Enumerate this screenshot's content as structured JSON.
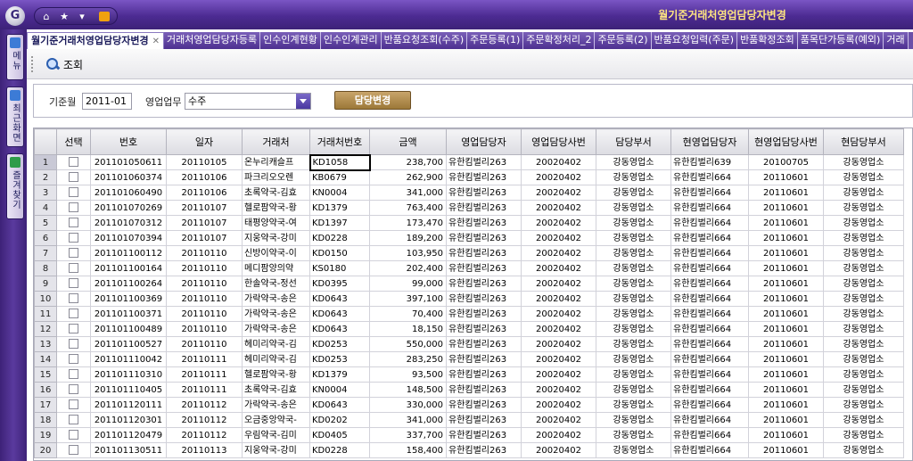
{
  "app": {
    "title": "월기준거래처영업담당자변경",
    "logo_letter": "G"
  },
  "sidebar": {
    "items": [
      {
        "label": "메뉴",
        "icon": "menu-icon"
      },
      {
        "label": "최근화면",
        "icon": "recent-screen-icon"
      },
      {
        "label": "즐겨찾기",
        "icon": "favorites-icon"
      }
    ]
  },
  "tabs": [
    {
      "label": "월기준거래처영업담당자변경",
      "active": true
    },
    {
      "label": "거래처영업담당자등록"
    },
    {
      "label": "인수인계현황"
    },
    {
      "label": "인수인계관리"
    },
    {
      "label": "반품요청조회(수주)"
    },
    {
      "label": "주문등록(1)"
    },
    {
      "label": "주문확정처리_2"
    },
    {
      "label": "주문등록(2)"
    },
    {
      "label": "반품요청입력(주문)"
    },
    {
      "label": "반품확정조회"
    },
    {
      "label": "품목단가등록(예외)"
    },
    {
      "label": "거래"
    }
  ],
  "toolbar": {
    "search_label": "조회"
  },
  "filter": {
    "month_label": "기준월",
    "month_value": "2011-01",
    "business_label": "영업업무",
    "business_value": "수주",
    "change_button": "담당변경"
  },
  "grid": {
    "columns": [
      "선택",
      "번호",
      "일자",
      "거래처",
      "거래처번호",
      "금액",
      "영업담당자",
      "영업담당사번",
      "담당부서",
      "현영업담당자",
      "현영업담당사번",
      "현담당부서"
    ],
    "rows": [
      [
        "1",
        "201101050611",
        "20110105",
        "온누리캐슬프",
        "KD1058",
        "238,700",
        "유한킴벌리263",
        "20020402",
        "강동영업소",
        "유한킴벌리639",
        "20100705",
        "강동영업소"
      ],
      [
        "2",
        "201101060374",
        "20110106",
        "파크리오오렌",
        "KB0679",
        "262,900",
        "유한킴벌리263",
        "20020402",
        "강동영업소",
        "유한킴벌리664",
        "20110601",
        "강동영업소"
      ],
      [
        "3",
        "201101060490",
        "20110106",
        "초록약국-김효",
        "KN0004",
        "341,000",
        "유한킴벌리263",
        "20020402",
        "강동영업소",
        "유한킴벌리664",
        "20110601",
        "강동영업소"
      ],
      [
        "4",
        "201101070269",
        "20110107",
        "헬로팜약국-황",
        "KD1379",
        "763,400",
        "유한킴벌리263",
        "20020402",
        "강동영업소",
        "유한킴벌리664",
        "20110601",
        "강동영업소"
      ],
      [
        "5",
        "201101070312",
        "20110107",
        "태평양약국-여",
        "KD1397",
        "173,470",
        "유한킴벌리263",
        "20020402",
        "강동영업소",
        "유한킴벌리664",
        "20110601",
        "강동영업소"
      ],
      [
        "6",
        "201101070394",
        "20110107",
        "지웅약국-강미",
        "KD0228",
        "189,200",
        "유한킴벌리263",
        "20020402",
        "강동영업소",
        "유한킴벌리664",
        "20110601",
        "강동영업소"
      ],
      [
        "7",
        "201101100112",
        "20110110",
        "신방이약국-이",
        "KD0150",
        "103,950",
        "유한킴벌리263",
        "20020402",
        "강동영업소",
        "유한킴벌리664",
        "20110601",
        "강동영업소"
      ],
      [
        "8",
        "201101100164",
        "20110110",
        "메디팜양의약",
        "KS0180",
        "202,400",
        "유한킴벌리263",
        "20020402",
        "강동영업소",
        "유한킴벌리664",
        "20110601",
        "강동영업소"
      ],
      [
        "9",
        "201101100264",
        "20110110",
        "한솔약국-정선",
        "KD0395",
        "99,000",
        "유한킴벌리263",
        "20020402",
        "강동영업소",
        "유한킴벌리664",
        "20110601",
        "강동영업소"
      ],
      [
        "10",
        "201101100369",
        "20110110",
        "가락약국-송은",
        "KD0643",
        "397,100",
        "유한킴벌리263",
        "20020402",
        "강동영업소",
        "유한킴벌리664",
        "20110601",
        "강동영업소"
      ],
      [
        "11",
        "201101100371",
        "20110110",
        "가락약국-송은",
        "KD0643",
        "70,400",
        "유한킴벌리263",
        "20020402",
        "강동영업소",
        "유한킴벌리664",
        "20110601",
        "강동영업소"
      ],
      [
        "12",
        "201101100489",
        "20110110",
        "가락약국-송은",
        "KD0643",
        "18,150",
        "유한킴벌리263",
        "20020402",
        "강동영업소",
        "유한킴벌리664",
        "20110601",
        "강동영업소"
      ],
      [
        "13",
        "201101100527",
        "20110110",
        "헤미리약국-김",
        "KD0253",
        "550,000",
        "유한킴벌리263",
        "20020402",
        "강동영업소",
        "유한킴벌리664",
        "20110601",
        "강동영업소"
      ],
      [
        "14",
        "201101110042",
        "20110111",
        "헤미리약국-김",
        "KD0253",
        "283,250",
        "유한킴벌리263",
        "20020402",
        "강동영업소",
        "유한킴벌리664",
        "20110601",
        "강동영업소"
      ],
      [
        "15",
        "201101110310",
        "20110111",
        "헬로팜약국-황",
        "KD1379",
        "93,500",
        "유한킴벌리263",
        "20020402",
        "강동영업소",
        "유한킴벌리664",
        "20110601",
        "강동영업소"
      ],
      [
        "16",
        "201101110405",
        "20110111",
        "초록약국-김효",
        "KN0004",
        "148,500",
        "유한킴벌리263",
        "20020402",
        "강동영업소",
        "유한킴벌리664",
        "20110601",
        "강동영업소"
      ],
      [
        "17",
        "201101120111",
        "20110112",
        "가락약국-송은",
        "KD0643",
        "330,000",
        "유한킴벌리263",
        "20020402",
        "강동영업소",
        "유한킴벌리664",
        "20110601",
        "강동영업소"
      ],
      [
        "18",
        "201101120301",
        "20110112",
        "오금중앙약국-",
        "KD0202",
        "341,000",
        "유한킴벌리263",
        "20020402",
        "강동영업소",
        "유한킴벌리664",
        "20110601",
        "강동영업소"
      ],
      [
        "19",
        "201101120479",
        "20110112",
        "우림약국-김미",
        "KD0405",
        "337,700",
        "유한킴벌리263",
        "20020402",
        "강동영업소",
        "유한킴벌리664",
        "20110601",
        "강동영업소"
      ],
      [
        "20",
        "201101130511",
        "20110113",
        "지웅약국-강미",
        "KD0228",
        "158,400",
        "유한킴벌리263",
        "20020402",
        "강동영업소",
        "유한킴벌리664",
        "20110601",
        "강동영업소"
      ]
    ]
  }
}
